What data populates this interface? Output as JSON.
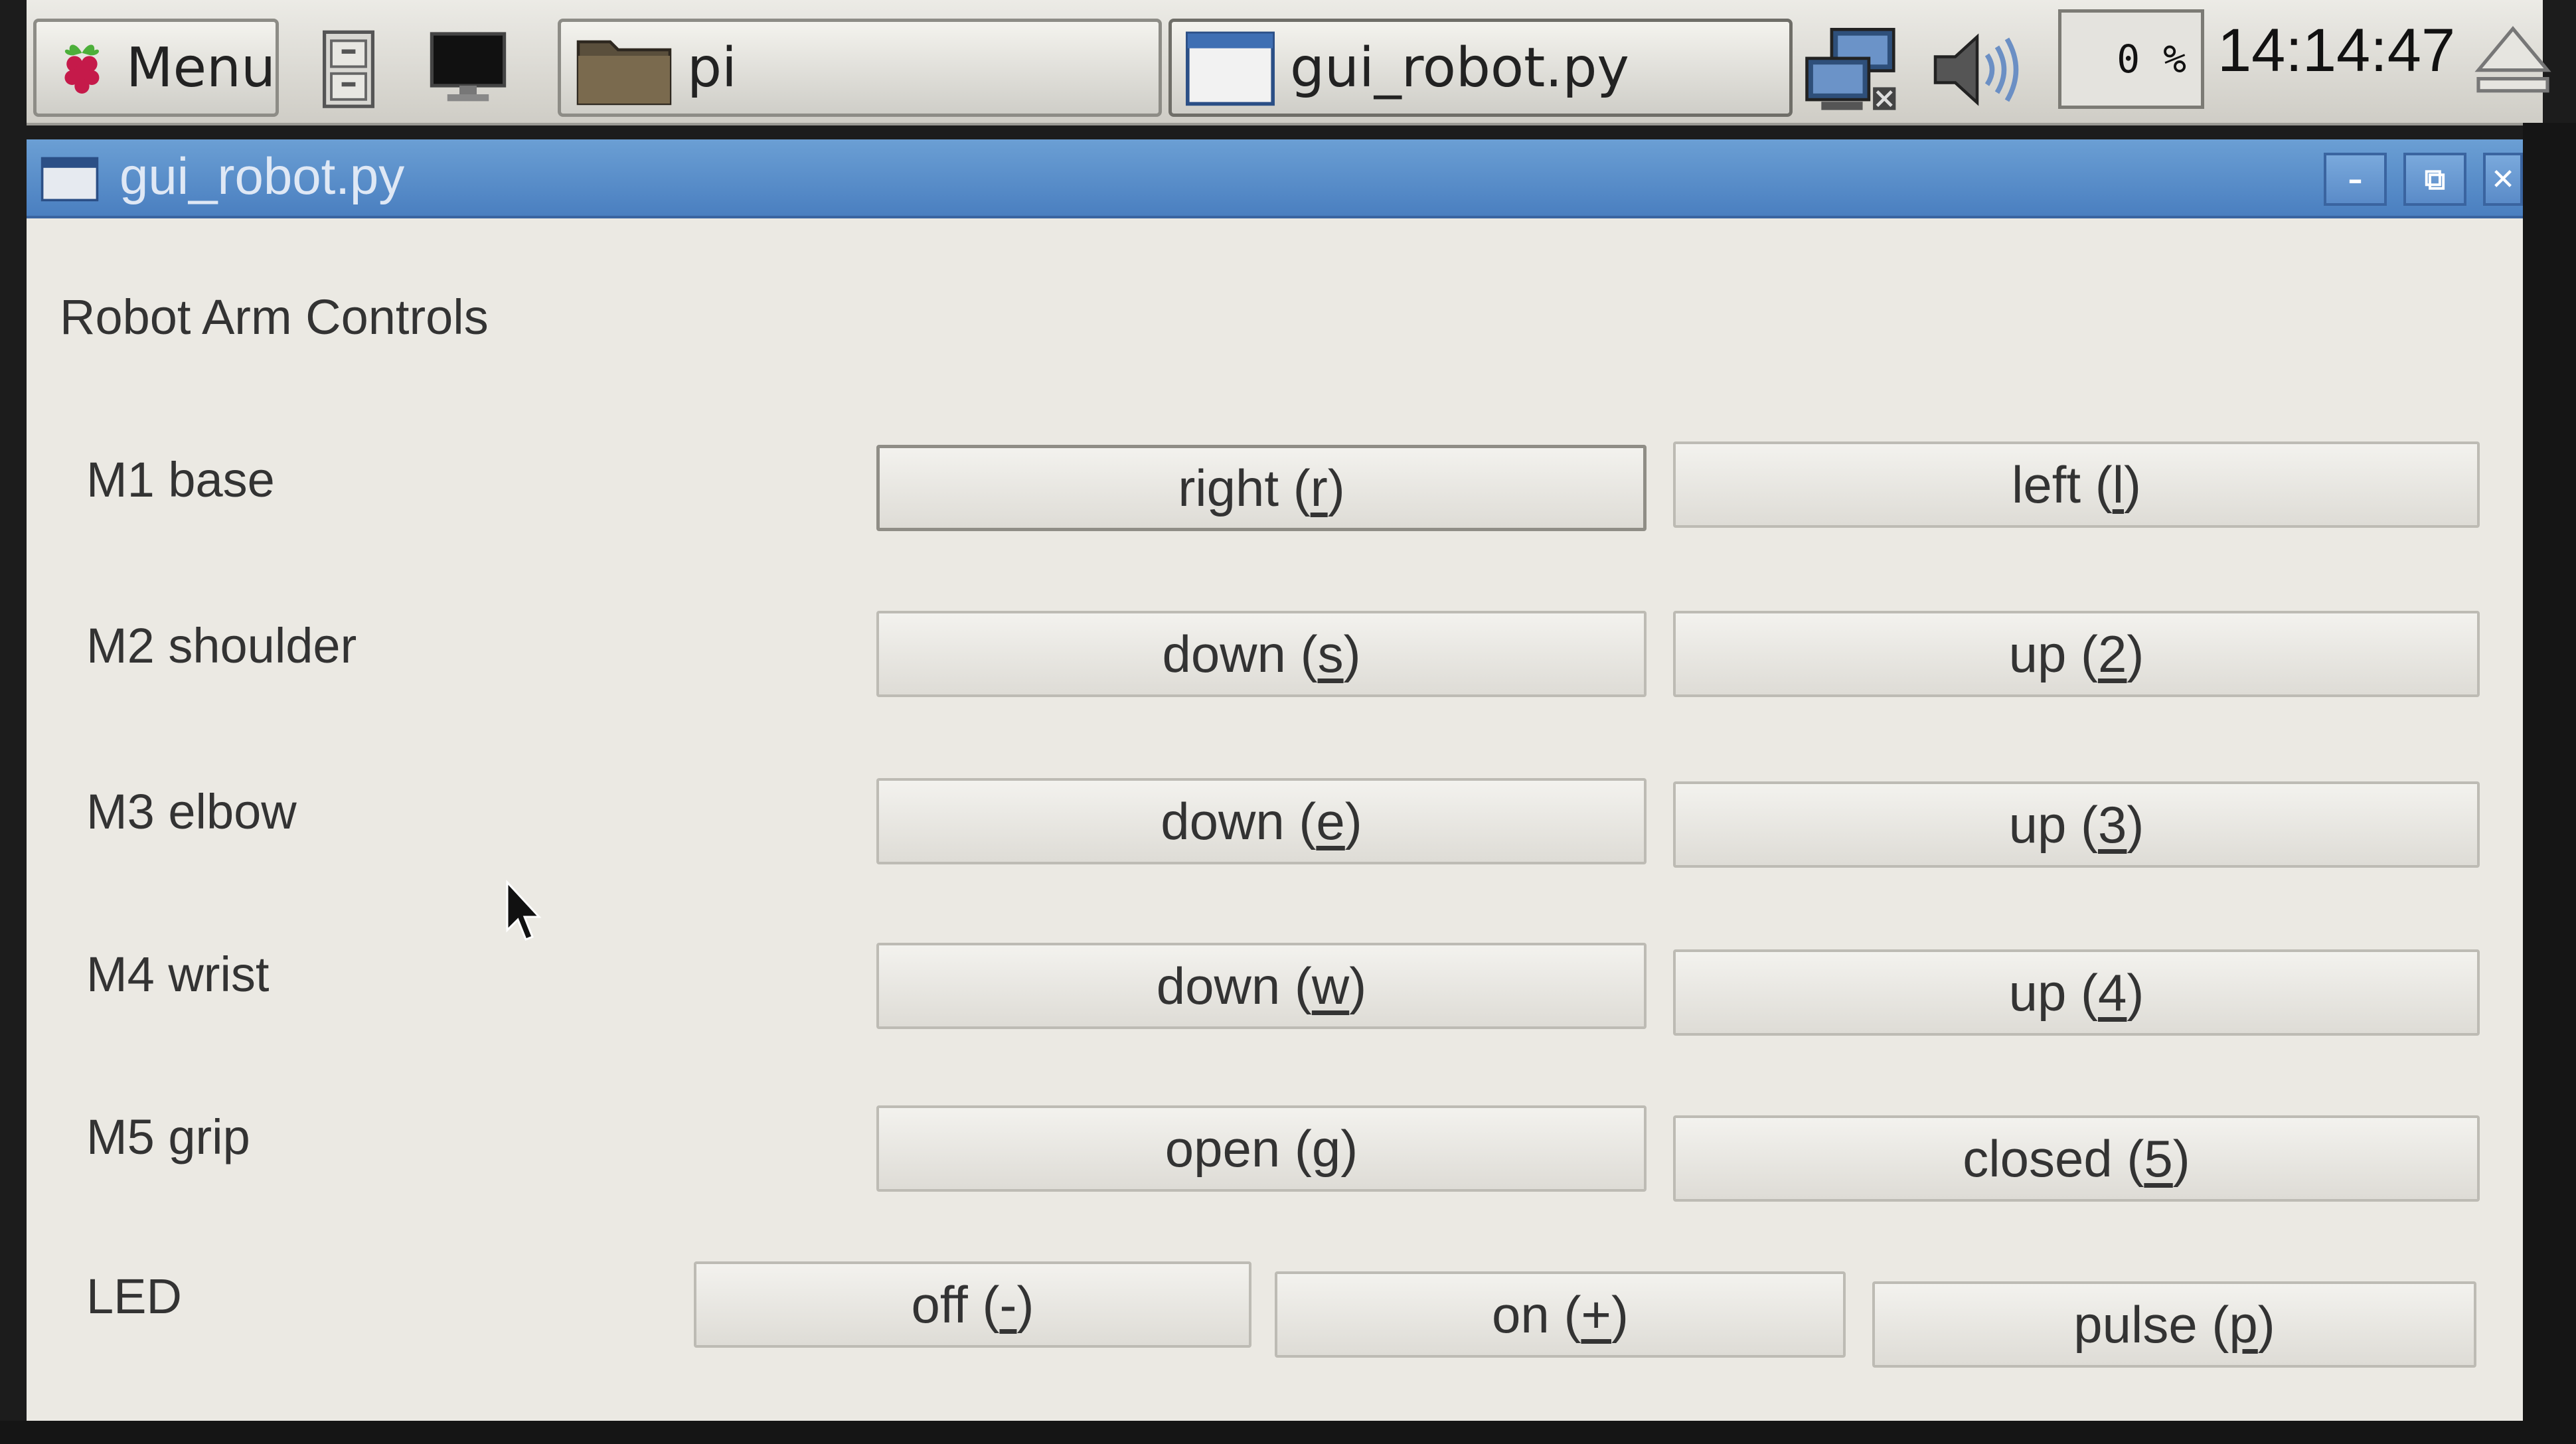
{
  "taskbar": {
    "menu_label": "Menu",
    "tasks": [
      {
        "label": "pi"
      },
      {
        "label": "gui_robot.py"
      }
    ],
    "cpu_usage": "0 %",
    "clock": "14:14:47"
  },
  "window": {
    "title": "gui_robot.py",
    "controls": {
      "minimize": "–",
      "maximize": "⧉",
      "close": "✕"
    }
  },
  "app": {
    "title": "Robot Arm Controls",
    "rows": [
      {
        "label": "M1 base",
        "buttons": [
          {
            "text": "right (",
            "key": "r",
            "after": ")"
          },
          {
            "text": "left (",
            "key": "l",
            "after": ")"
          }
        ]
      },
      {
        "label": "M2 shoulder",
        "buttons": [
          {
            "text": "down (",
            "key": "s",
            "after": ")"
          },
          {
            "text": "up (",
            "key": "2",
            "after": ")"
          }
        ]
      },
      {
        "label": "M3 elbow",
        "buttons": [
          {
            "text": "down (",
            "key": "e",
            "after": ")"
          },
          {
            "text": "up (",
            "key": "3",
            "after": ")"
          }
        ]
      },
      {
        "label": "M4 wrist",
        "buttons": [
          {
            "text": "down (",
            "key": "w",
            "after": ")"
          },
          {
            "text": "up (",
            "key": "4",
            "after": ")"
          }
        ]
      },
      {
        "label": "M5 grip",
        "buttons": [
          {
            "text": "open (",
            "key": "g",
            "after": ")"
          },
          {
            "text": "closed (",
            "key": "5",
            "after": ")"
          }
        ]
      },
      {
        "label": "LED",
        "buttons": [
          {
            "text": "off (",
            "key": "-",
            "after": ")"
          },
          {
            "text": "on (",
            "key": "+",
            "after": ")"
          },
          {
            "text": "pulse (",
            "key": "p",
            "after": ")"
          }
        ]
      }
    ]
  }
}
